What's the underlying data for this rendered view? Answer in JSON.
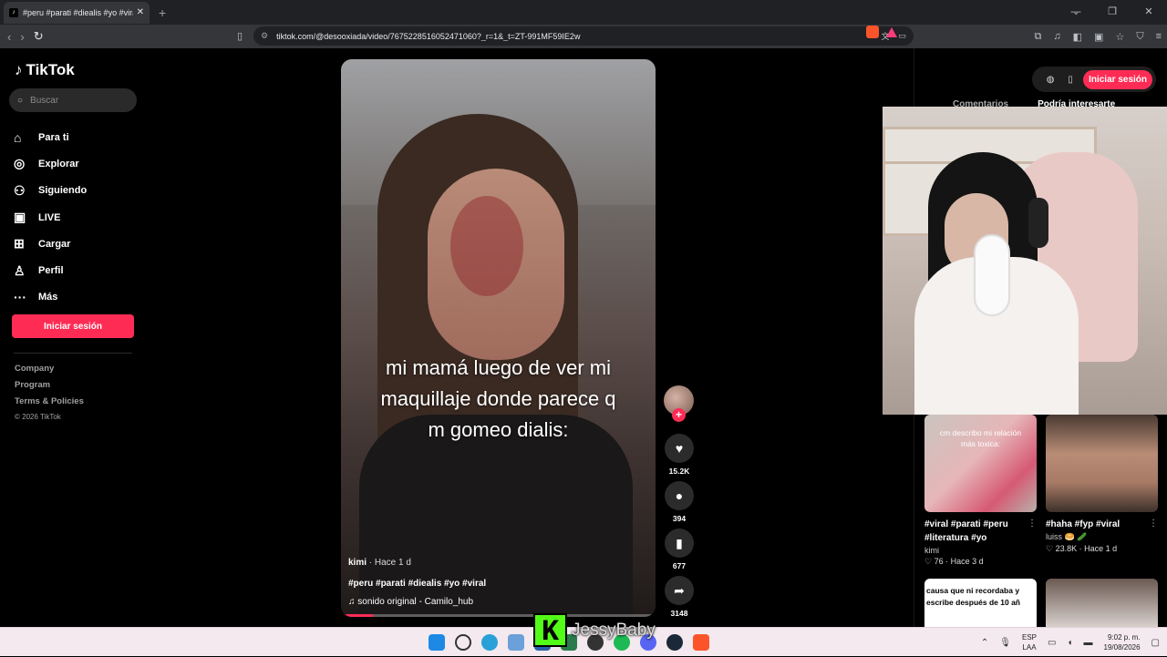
{
  "browser": {
    "tab_title": "#peru #parati #diealis #yo #viral",
    "url": "tiktok.com/@desooxiada/video/7675228516052471060?_r=1&_t=ZT-991MF59IE2w"
  },
  "sidebar": {
    "logo": "TikTok",
    "search_placeholder": "Buscar",
    "items": [
      {
        "label": "Para ti",
        "icon": "home-icon"
      },
      {
        "label": "Explorar",
        "icon": "compass-icon"
      },
      {
        "label": "Siguiendo",
        "icon": "following-icon"
      },
      {
        "label": "LIVE",
        "icon": "live-icon"
      },
      {
        "label": "Cargar",
        "icon": "upload-icon"
      },
      {
        "label": "Perfil",
        "icon": "profile-icon"
      },
      {
        "label": "Más",
        "icon": "more-icon"
      }
    ],
    "login_label": "Iniciar sesión",
    "footer": {
      "company": "Company",
      "program": "Program",
      "terms": "Terms & Policies",
      "copyright": "© 2026 TikTok"
    }
  },
  "video": {
    "caption_line1": "mi mamá luego de ver mi",
    "caption_line2": "maquillaje donde parece q",
    "caption_line3": "m gomeo dialis:",
    "author": "kimi",
    "time_ago": " · Hace 1 d",
    "hashtags": "#peru #parati #diealis #yo #viral",
    "sound": "sonido original - Camilo_hub",
    "progress": 0.1
  },
  "actions": {
    "likes": "15.2K",
    "comments": "394",
    "saves": "677",
    "shares": "3148"
  },
  "right_panel": {
    "login_label": "Iniciar sesión",
    "tab_comments": "Comentarios",
    "tab_suggested": "Podría interesarte",
    "recommendations": [
      {
        "thumb_text": "cm describo mi relación\nmás toxica:",
        "title": "#viral #parati #peru #literatura #yo",
        "user": "kimi",
        "likes": "76",
        "ago": "Hace 3 d"
      },
      {
        "thumb_text": "",
        "title": "#haha #fyp #viral",
        "user": "luiss 🥯 🥒",
        "likes": "23.8K",
        "ago": "Hace 1 d"
      }
    ],
    "rec3_text": "causa que ni recordaba y\nescribe después de 10 añ"
  },
  "overlay": {
    "kick_letter": "K",
    "streamer_name": "JessyBaby"
  },
  "taskbar": {
    "lang_line1": "ESP",
    "lang_line2": "LAA",
    "time": "9:02 p. m.",
    "date": "19/08/2026"
  },
  "colors": {
    "accent": "#fe2c55",
    "background": "#000000",
    "kick": "#53fc18"
  }
}
